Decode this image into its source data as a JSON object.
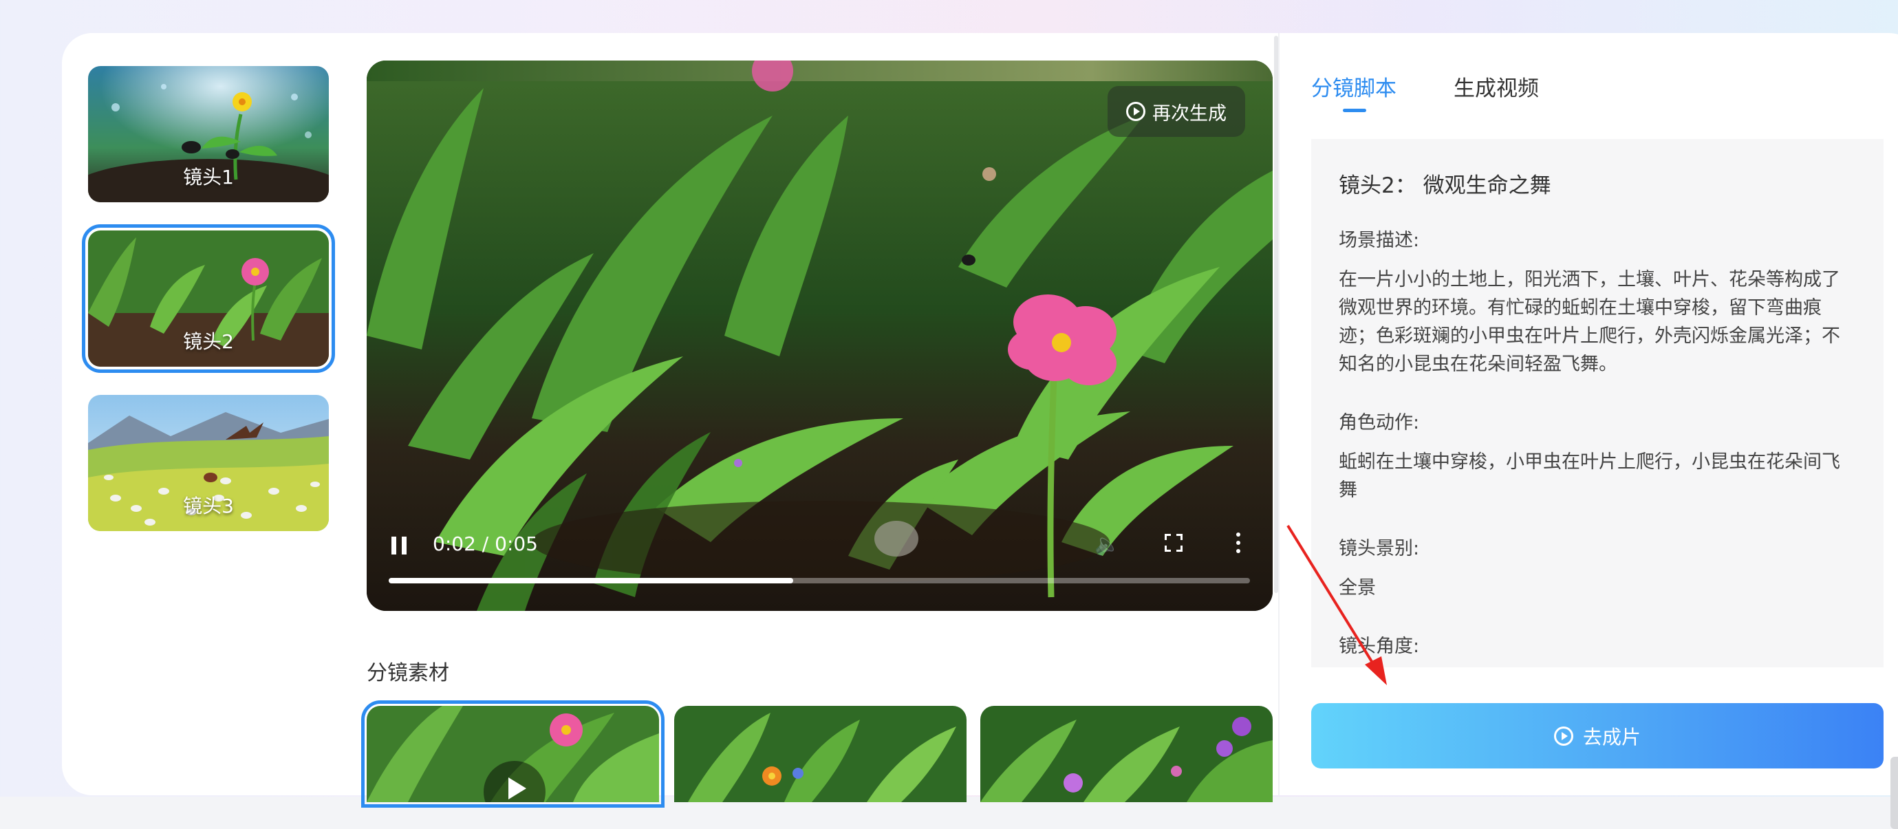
{
  "shots": [
    {
      "label": "镜头1",
      "active": false
    },
    {
      "label": "镜头2",
      "active": true
    },
    {
      "label": "镜头3",
      "active": false
    }
  ],
  "video": {
    "regenerate_label": "再次生成",
    "time": "0:02 / 0:05",
    "progress": 0.47
  },
  "materials": {
    "title": "分镜素材"
  },
  "tabs": {
    "storyboard": "分镜脚本",
    "generate": "生成视频"
  },
  "script": {
    "title": "镜头2： 微观生命之舞",
    "scene_label": "场景描述:",
    "scene_text": "在一片小小的土地上，阳光洒下，土壤、叶片、花朵等构成了微观世界的环境。有忙碌的蚯蚓在土壤中穿梭，留下弯曲痕迹；色彩斑斓的小甲虫在叶片上爬行，外壳闪烁金属光泽；不知名的小昆虫在花朵间轻盈飞舞。",
    "action_label": "角色动作:",
    "action_text": "蚯蚓在土壤中穿梭，小甲虫在叶片上爬行，小昆虫在花朵间飞舞",
    "shot_type_label": "镜头景别:",
    "shot_type_value": "全景",
    "angle_label": "镜头角度:"
  },
  "go_button_label": "去成片",
  "colors": {
    "accent": "#2d8cf0",
    "arrow": "#e8231f"
  }
}
